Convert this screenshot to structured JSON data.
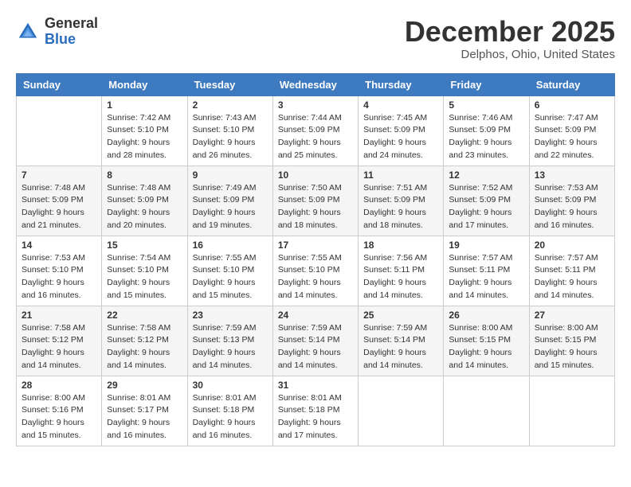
{
  "header": {
    "logo_general": "General",
    "logo_blue": "Blue",
    "month_title": "December 2025",
    "location": "Delphos, Ohio, United States"
  },
  "days_of_week": [
    "Sunday",
    "Monday",
    "Tuesday",
    "Wednesday",
    "Thursday",
    "Friday",
    "Saturday"
  ],
  "weeks": [
    [
      {
        "day": "",
        "sunrise": "",
        "sunset": "",
        "daylight": ""
      },
      {
        "day": "1",
        "sunrise": "Sunrise: 7:42 AM",
        "sunset": "Sunset: 5:10 PM",
        "daylight": "Daylight: 9 hours and 28 minutes."
      },
      {
        "day": "2",
        "sunrise": "Sunrise: 7:43 AM",
        "sunset": "Sunset: 5:10 PM",
        "daylight": "Daylight: 9 hours and 26 minutes."
      },
      {
        "day": "3",
        "sunrise": "Sunrise: 7:44 AM",
        "sunset": "Sunset: 5:09 PM",
        "daylight": "Daylight: 9 hours and 25 minutes."
      },
      {
        "day": "4",
        "sunrise": "Sunrise: 7:45 AM",
        "sunset": "Sunset: 5:09 PM",
        "daylight": "Daylight: 9 hours and 24 minutes."
      },
      {
        "day": "5",
        "sunrise": "Sunrise: 7:46 AM",
        "sunset": "Sunset: 5:09 PM",
        "daylight": "Daylight: 9 hours and 23 minutes."
      },
      {
        "day": "6",
        "sunrise": "Sunrise: 7:47 AM",
        "sunset": "Sunset: 5:09 PM",
        "daylight": "Daylight: 9 hours and 22 minutes."
      }
    ],
    [
      {
        "day": "7",
        "sunrise": "Sunrise: 7:48 AM",
        "sunset": "Sunset: 5:09 PM",
        "daylight": "Daylight: 9 hours and 21 minutes."
      },
      {
        "day": "8",
        "sunrise": "Sunrise: 7:48 AM",
        "sunset": "Sunset: 5:09 PM",
        "daylight": "Daylight: 9 hours and 20 minutes."
      },
      {
        "day": "9",
        "sunrise": "Sunrise: 7:49 AM",
        "sunset": "Sunset: 5:09 PM",
        "daylight": "Daylight: 9 hours and 19 minutes."
      },
      {
        "day": "10",
        "sunrise": "Sunrise: 7:50 AM",
        "sunset": "Sunset: 5:09 PM",
        "daylight": "Daylight: 9 hours and 18 minutes."
      },
      {
        "day": "11",
        "sunrise": "Sunrise: 7:51 AM",
        "sunset": "Sunset: 5:09 PM",
        "daylight": "Daylight: 9 hours and 18 minutes."
      },
      {
        "day": "12",
        "sunrise": "Sunrise: 7:52 AM",
        "sunset": "Sunset: 5:09 PM",
        "daylight": "Daylight: 9 hours and 17 minutes."
      },
      {
        "day": "13",
        "sunrise": "Sunrise: 7:53 AM",
        "sunset": "Sunset: 5:09 PM",
        "daylight": "Daylight: 9 hours and 16 minutes."
      }
    ],
    [
      {
        "day": "14",
        "sunrise": "Sunrise: 7:53 AM",
        "sunset": "Sunset: 5:10 PM",
        "daylight": "Daylight: 9 hours and 16 minutes."
      },
      {
        "day": "15",
        "sunrise": "Sunrise: 7:54 AM",
        "sunset": "Sunset: 5:10 PM",
        "daylight": "Daylight: 9 hours and 15 minutes."
      },
      {
        "day": "16",
        "sunrise": "Sunrise: 7:55 AM",
        "sunset": "Sunset: 5:10 PM",
        "daylight": "Daylight: 9 hours and 15 minutes."
      },
      {
        "day": "17",
        "sunrise": "Sunrise: 7:55 AM",
        "sunset": "Sunset: 5:10 PM",
        "daylight": "Daylight: 9 hours and 14 minutes."
      },
      {
        "day": "18",
        "sunrise": "Sunrise: 7:56 AM",
        "sunset": "Sunset: 5:11 PM",
        "daylight": "Daylight: 9 hours and 14 minutes."
      },
      {
        "day": "19",
        "sunrise": "Sunrise: 7:57 AM",
        "sunset": "Sunset: 5:11 PM",
        "daylight": "Daylight: 9 hours and 14 minutes."
      },
      {
        "day": "20",
        "sunrise": "Sunrise: 7:57 AM",
        "sunset": "Sunset: 5:11 PM",
        "daylight": "Daylight: 9 hours and 14 minutes."
      }
    ],
    [
      {
        "day": "21",
        "sunrise": "Sunrise: 7:58 AM",
        "sunset": "Sunset: 5:12 PM",
        "daylight": "Daylight: 9 hours and 14 minutes."
      },
      {
        "day": "22",
        "sunrise": "Sunrise: 7:58 AM",
        "sunset": "Sunset: 5:12 PM",
        "daylight": "Daylight: 9 hours and 14 minutes."
      },
      {
        "day": "23",
        "sunrise": "Sunrise: 7:59 AM",
        "sunset": "Sunset: 5:13 PM",
        "daylight": "Daylight: 9 hours and 14 minutes."
      },
      {
        "day": "24",
        "sunrise": "Sunrise: 7:59 AM",
        "sunset": "Sunset: 5:14 PM",
        "daylight": "Daylight: 9 hours and 14 minutes."
      },
      {
        "day": "25",
        "sunrise": "Sunrise: 7:59 AM",
        "sunset": "Sunset: 5:14 PM",
        "daylight": "Daylight: 9 hours and 14 minutes."
      },
      {
        "day": "26",
        "sunrise": "Sunrise: 8:00 AM",
        "sunset": "Sunset: 5:15 PM",
        "daylight": "Daylight: 9 hours and 14 minutes."
      },
      {
        "day": "27",
        "sunrise": "Sunrise: 8:00 AM",
        "sunset": "Sunset: 5:15 PM",
        "daylight": "Daylight: 9 hours and 15 minutes."
      }
    ],
    [
      {
        "day": "28",
        "sunrise": "Sunrise: 8:00 AM",
        "sunset": "Sunset: 5:16 PM",
        "daylight": "Daylight: 9 hours and 15 minutes."
      },
      {
        "day": "29",
        "sunrise": "Sunrise: 8:01 AM",
        "sunset": "Sunset: 5:17 PM",
        "daylight": "Daylight: 9 hours and 16 minutes."
      },
      {
        "day": "30",
        "sunrise": "Sunrise: 8:01 AM",
        "sunset": "Sunset: 5:18 PM",
        "daylight": "Daylight: 9 hours and 16 minutes."
      },
      {
        "day": "31",
        "sunrise": "Sunrise: 8:01 AM",
        "sunset": "Sunset: 5:18 PM",
        "daylight": "Daylight: 9 hours and 17 minutes."
      },
      {
        "day": "",
        "sunrise": "",
        "sunset": "",
        "daylight": ""
      },
      {
        "day": "",
        "sunrise": "",
        "sunset": "",
        "daylight": ""
      },
      {
        "day": "",
        "sunrise": "",
        "sunset": "",
        "daylight": ""
      }
    ]
  ]
}
